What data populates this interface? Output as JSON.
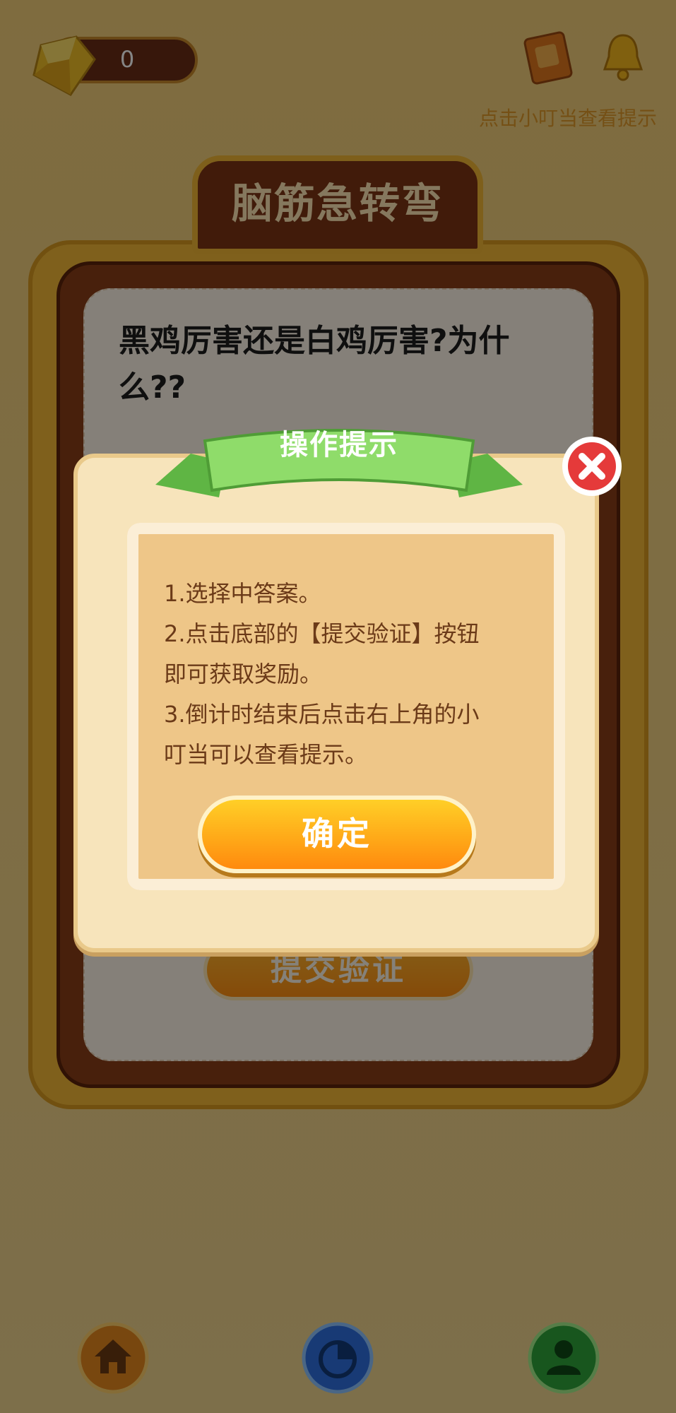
{
  "topbar": {
    "coin_count": "0",
    "hint_label": "点击小叮当查看提示"
  },
  "board": {
    "title": "脑筋急转弯",
    "question": "黑鸡厉害还是白鸡厉害?为什么??",
    "submit_label": "提交验证"
  },
  "modal": {
    "title": "操作提示",
    "lines": [
      "1.选择中答案。",
      "2.点击底部的【提交验证】按钮",
      "即可获取奖励。",
      "3.倒计时结束后点击右上角的小",
      "叮当可以查看提示。"
    ],
    "confirm_label": "确定"
  },
  "bottom_nav": {
    "items": [
      {
        "icon": "home-icon",
        "color": "#e6891e"
      },
      {
        "icon": "pie-chart-icon",
        "color": "#2f6fe0"
      },
      {
        "icon": "user-icon",
        "color": "#2fa63a"
      }
    ]
  },
  "colors": {
    "overlay": "rgba(0,0,0,0.48)",
    "accent_orange": "#ffa617",
    "ribbon_green": "#7fcf5b",
    "close_red": "#e53a3a"
  }
}
